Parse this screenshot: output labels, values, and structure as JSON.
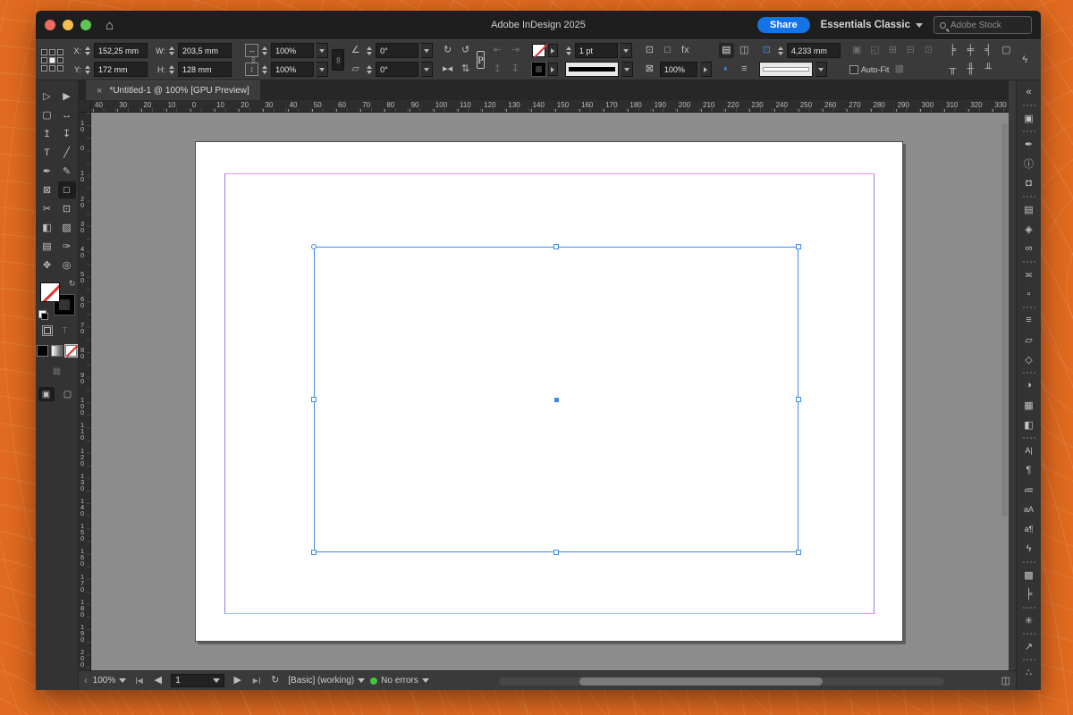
{
  "colors": {
    "accent_blue": "#3f8ae8",
    "margin_magenta": "#f78ded",
    "column_violet": "#8e7cf2",
    "share_blue": "#1473e6",
    "error_free_green": "#44c33c",
    "desktop_orange": "#e06a1f"
  },
  "titlebar": {
    "title": "Adobe InDesign 2025",
    "share_label": "Share",
    "workspace_label": "Essentials Classic",
    "search_placeholder": "Adobe Stock"
  },
  "control_panel": {
    "x_label": "X:",
    "x_value": "152,25 mm",
    "y_label": "Y:",
    "y_value": "172 mm",
    "w_label": "W:",
    "w_value": "203,5 mm",
    "h_label": "H:",
    "h_value": "128 mm",
    "scale_x_value": "100%",
    "scale_y_value": "100%",
    "rotation_value": "0°",
    "shear_value": "0°",
    "container_indicator": "P",
    "stroke_weight_value": "1 pt",
    "opacity_value": "100%",
    "wrap_offset_value": "4,233 mm",
    "autofit_label": "Auto-Fit"
  },
  "document_tab": {
    "close_glyph": "×",
    "title": "*Untitled-1 @ 100% [GPU Preview]"
  },
  "rulers": {
    "h_labels": [
      "40",
      "30",
      "20",
      "10",
      "0",
      "10",
      "20",
      "30",
      "40",
      "50",
      "60",
      "70",
      "80",
      "90",
      "100",
      "110",
      "120",
      "130",
      "140",
      "150",
      "160",
      "170",
      "180",
      "190",
      "200",
      "210",
      "220",
      "230",
      "240",
      "250",
      "260",
      "270",
      "280",
      "290",
      "300",
      "310",
      "320",
      "330"
    ],
    "v_labels": [
      "10",
      "0",
      "10",
      "20",
      "30",
      "40",
      "50",
      "60",
      "70",
      "80",
      "90",
      "100",
      "110",
      "120",
      "130",
      "140",
      "150",
      "160",
      "170",
      "180",
      "190",
      "200"
    ]
  },
  "icon_sets": {
    "constrain": [
      {
        "n": "constrain-proportions-chain-icon",
        "g": "∞"
      }
    ],
    "transform_row1": [
      {
        "n": "rotate-90-cw-icon",
        "g": "↻"
      },
      {
        "n": "rotate-90-ccw-icon",
        "g": "↺"
      }
    ],
    "transform_row2": [
      {
        "n": "flip-horizontal-icon",
        "g": "▸◂"
      },
      {
        "n": "flip-vertical-icon",
        "g": "⇅"
      }
    ],
    "distribute_row1": [
      {
        "n": "distribute-space-h-icon",
        "g": "⇤",
        "dim": true
      },
      {
        "n": "distribute-space-v-icon",
        "g": "⇥",
        "dim": true
      }
    ],
    "distribute_row2": [
      {
        "n": "distribute-top-icon",
        "g": "↥",
        "dim": true
      },
      {
        "n": "distribute-bottom-icon",
        "g": "↧",
        "dim": true
      }
    ],
    "corner_row1": [
      {
        "n": "corner-options-icon",
        "g": "⊡"
      },
      {
        "n": "corner-shape-icon",
        "g": "□"
      },
      {
        "n": "effects-fx-icon",
        "g": "fx"
      }
    ],
    "corner_row2": [
      {
        "n": "opacity-icon",
        "g": "⊠"
      }
    ],
    "wrap_row1": [
      {
        "n": "no-text-wrap-icon",
        "g": "▤",
        "sel": true
      },
      {
        "n": "wrap-around-bounding-box-icon",
        "g": "◫"
      }
    ],
    "wrap_row2": [
      {
        "n": "drop-shadow-icon",
        "g": "◐",
        "blue": true
      },
      {
        "n": "align-center-quick-icon",
        "g": "≡"
      }
    ],
    "wrap_offset": [
      {
        "n": "wrap-offset-icon",
        "g": "⊡",
        "blue": true
      }
    ],
    "fit_row1": [
      {
        "n": "fill-frame-proportionally-icon",
        "g": "▣",
        "dim": true
      },
      {
        "n": "fit-content-proportionally-icon",
        "g": "◱",
        "dim": true
      },
      {
        "n": "fit-frame-to-content-icon",
        "g": "⊞",
        "dim": true
      },
      {
        "n": "fit-content-to-frame-icon",
        "g": "⊟",
        "dim": true
      },
      {
        "n": "center-content-icon",
        "g": "⊡",
        "dim": true
      }
    ],
    "fit_row2": [
      {
        "n": "content-grabber-icon",
        "g": "▩",
        "dim": true
      }
    ],
    "align_row1": [
      {
        "n": "align-left-icon",
        "g": "╞"
      },
      {
        "n": "align-center-icon",
        "g": "╪"
      },
      {
        "n": "align-right-icon",
        "g": "╡"
      },
      {
        "n": "frame-fitting-options-icon",
        "g": "▢"
      }
    ],
    "align_row2": [
      {
        "n": "align-top-icon",
        "g": "╥"
      },
      {
        "n": "align-middle-icon",
        "g": "╫"
      },
      {
        "n": "align-bottom-icon",
        "g": "╨"
      }
    ],
    "gpu_bolt": [
      {
        "n": "gpu-performance-icon",
        "g": "ϟ"
      }
    ],
    "gear_col": [
      {
        "n": "settings-gear-icon",
        "g": "✳"
      },
      {
        "n": "panel-menu-icon",
        "g": "≡"
      }
    ],
    "statusbar_nav": [
      {
        "n": "first-page-icon",
        "g": "◀",
        "bar": "left"
      },
      {
        "n": "prev-page-icon",
        "g": "◀"
      }
    ],
    "statusbar_nav2": [
      {
        "n": "next-page-icon",
        "g": "▶"
      },
      {
        "n": "last-page-icon",
        "g": "▶",
        "bar": "right"
      },
      {
        "n": "preflight-menu-icon",
        "g": "↻"
      }
    ]
  },
  "tools": {
    "rows": [
      {
        "n": "selection-tool",
        "g": "▷"
      },
      {
        "n": "direct-selection-tool",
        "g": "▶"
      },
      {
        "n": "page-tool",
        "g": "▢"
      },
      {
        "n": "gap-tool",
        "g": "↔"
      },
      {
        "n": "content-collector-tool",
        "g": "↥"
      },
      {
        "n": "content-placer-tool",
        "g": "↧"
      },
      {
        "n": "type-tool",
        "g": "T"
      },
      {
        "n": "line-tool",
        "g": "╱"
      },
      {
        "n": "pen-tool",
        "g": "✒"
      },
      {
        "n": "pencil-tool",
        "g": "✎"
      },
      {
        "n": "frame-tool",
        "g": "⊠"
      },
      {
        "n": "rectangle-tool",
        "g": "□",
        "sel": true
      },
      {
        "n": "scissors-tool",
        "g": "✂"
      },
      {
        "n": "free-transform-tool",
        "g": "⊡"
      },
      {
        "n": "gradient-swatch-tool",
        "g": "◧"
      },
      {
        "n": "gradient-feather-tool",
        "g": "▨"
      },
      {
        "n": "note-tool",
        "g": "▤"
      },
      {
        "n": "eyedropper-tool",
        "g": "✑"
      },
      {
        "n": "hand-tool",
        "g": "✥"
      },
      {
        "n": "zoom-tool",
        "g": "◎"
      }
    ],
    "text_toggle_label": "T",
    "screen_mode_glyph": "▦",
    "normal_view_glyph": "▣",
    "preview_view_glyph": "▢"
  },
  "right_dock": {
    "icons": [
      {
        "n": "collapse-panels-icon",
        "g": "«"
      },
      {
        "n": "pages-panel-icon",
        "g": "▣",
        "sep": true
      },
      {
        "n": "cc-libraries-panel-icon",
        "g": "✒",
        "sep": true
      },
      {
        "n": "properties-panel-icon",
        "g": "ⓘ"
      },
      {
        "n": "comments-panel-icon",
        "g": "◘"
      },
      {
        "n": "bookmarks-panel-icon",
        "g": "▤",
        "sep": true
      },
      {
        "n": "layers-panel-icon",
        "g": "◈"
      },
      {
        "n": "links-panel-icon",
        "g": "∞"
      },
      {
        "n": "stroke-panel-icon",
        "g": "≍",
        "sep": true
      },
      {
        "n": "grids-panel-icon",
        "g": "▫"
      },
      {
        "n": "text-frame-options-panel-icon",
        "g": "≡",
        "sep": true
      },
      {
        "n": "object-states-panel-icon",
        "g": "▱"
      },
      {
        "n": "pathfinder-panel-icon",
        "g": "◇"
      },
      {
        "n": "color-panel-icon",
        "g": "◑",
        "sep": true
      },
      {
        "n": "swatches-panel-icon",
        "g": "▦"
      },
      {
        "n": "gradient-panel-icon",
        "g": "◧"
      },
      {
        "n": "character-panel-icon",
        "g": "A|",
        "small": true,
        "sep": true
      },
      {
        "n": "paragraph-panel-icon",
        "g": "¶"
      },
      {
        "n": "glyphs-panel-icon",
        "g": "≔"
      },
      {
        "n": "character-styles-panel-icon",
        "g": "aA",
        "small": true
      },
      {
        "n": "paragraph-styles-panel-icon",
        "g": "a¶",
        "small": true
      },
      {
        "n": "quick-apply-panel-icon",
        "g": "ϟ"
      },
      {
        "n": "object-styles-panel-icon",
        "g": "▩",
        "sep": true
      },
      {
        "n": "align-panel-icon",
        "g": "╞"
      },
      {
        "n": "effects-panel-icon",
        "g": "✳",
        "sep": true
      },
      {
        "n": "export-panel-icon",
        "g": "↗",
        "sep": true
      },
      {
        "n": "adobe-express-panel-icon",
        "g": "∴",
        "sep": true
      }
    ]
  },
  "statusbar": {
    "collapse_glyph": "‹",
    "zoom_value": "100%",
    "page_value": "1",
    "preflight_label": "[Basic] (working)",
    "errors_label": "No errors"
  }
}
